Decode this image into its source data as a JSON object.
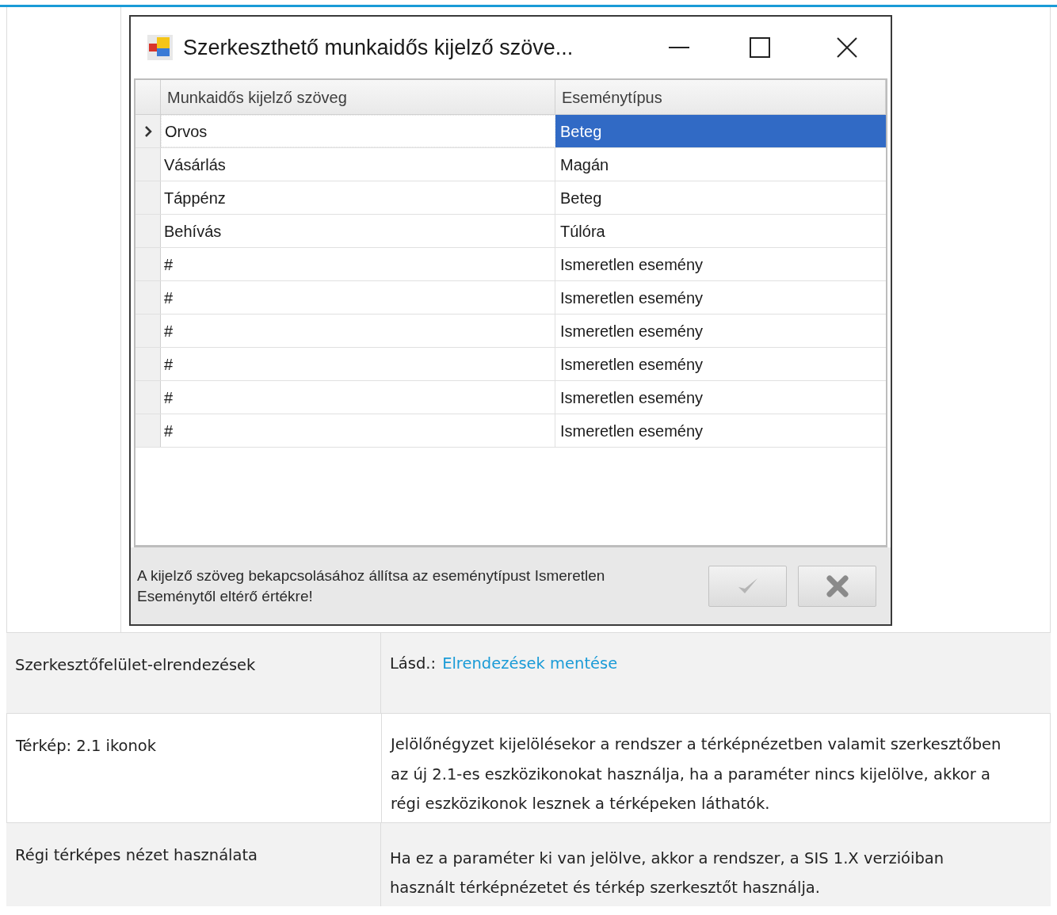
{
  "dialog": {
    "title": "Szerkeszthető munkaidős kijelző szöve...",
    "columns": [
      "Munkaidős kijelző szöveg",
      "Eseménytípus"
    ],
    "rows": [
      {
        "text": "Orvos",
        "type": "Beteg",
        "selected": true
      },
      {
        "text": "Vásárlás",
        "type": "Magán",
        "selected": false
      },
      {
        "text": "Táppénz",
        "type": "Beteg",
        "selected": false
      },
      {
        "text": "Behívás",
        "type": "Túlóra",
        "selected": false
      },
      {
        "text": "#",
        "type": "Ismeretlen esemény",
        "selected": false
      },
      {
        "text": "#",
        "type": "Ismeretlen esemény",
        "selected": false
      },
      {
        "text": "#",
        "type": "Ismeretlen esemény",
        "selected": false
      },
      {
        "text": "#",
        "type": "Ismeretlen esemény",
        "selected": false
      },
      {
        "text": "#",
        "type": "Ismeretlen esemény",
        "selected": false
      },
      {
        "text": "#",
        "type": "Ismeretlen esemény",
        "selected": false
      }
    ],
    "hint": "A kijelző szöveg bekapcsolásához állítsa az eseménytípust Ismeretlen Eseménytől eltérő értékre!",
    "buttons": [
      {
        "kind": "ok"
      },
      {
        "kind": "cancel"
      }
    ]
  },
  "settings": [
    {
      "name": "Szerkesztőfelület-elrendezések",
      "prefix": "Lásd.:",
      "link": "Elrendezések mentése"
    },
    {
      "name": "Térkép: 2.1 ikonok",
      "description": "Jelölőnégyzet kijelölésekor a rendszer a térképnézetben valamit szerkesztőben az új 2.1-es eszközikonokat használja, ha a paraméter nincs kijelölve, akkor a régi eszközikonok lesznek a térképeken láthatók."
    },
    {
      "name": "Régi térképes nézet használata",
      "description": "Ha ez a paraméter ki van jelölve, akkor a rendszer, a SIS 1.X verzióiban használt térképnézetet és térkép szerkesztőt használja."
    }
  ]
}
